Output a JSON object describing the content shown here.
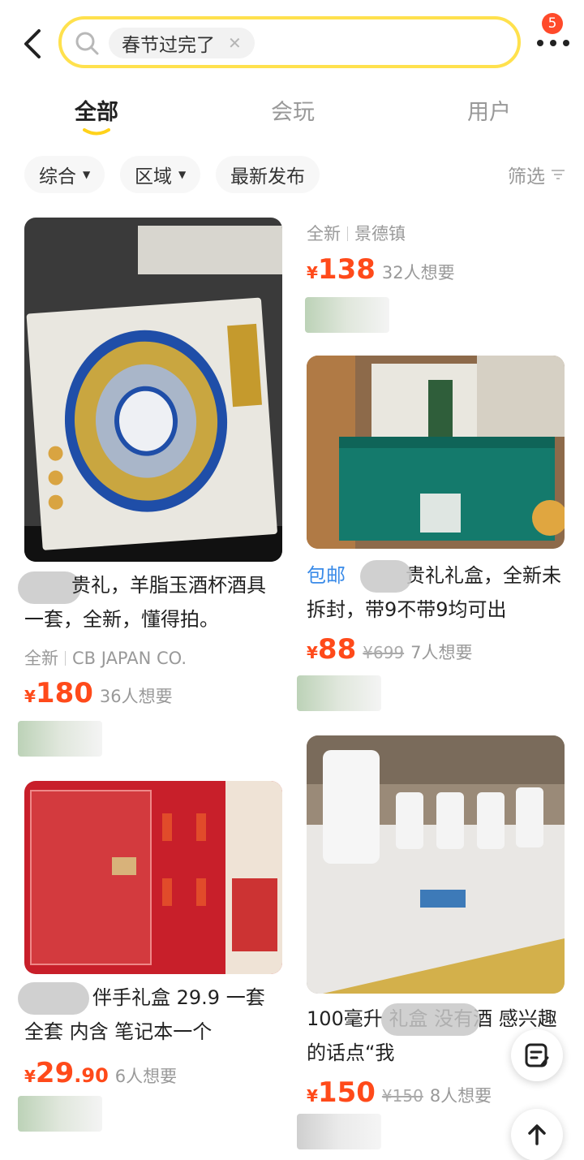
{
  "header": {
    "search_query": "春节过完了",
    "notification_count": "5"
  },
  "tabs": [
    {
      "label": "全部"
    },
    {
      "label": "会玩"
    },
    {
      "label": "用户"
    }
  ],
  "filters": {
    "sort": "综合",
    "region": "区域",
    "latest": "最新发布",
    "screen": "筛选"
  },
  "items": [
    {
      "title": "贵礼，羊脂玉酒杯酒具一套，全新，懂得拍。",
      "condition": "全新",
      "brand": "CB JAPAN CO.",
      "price": "180",
      "wants": "36人想要"
    },
    {
      "condition": "全新",
      "location": "景德镇",
      "price": "138",
      "wants": "32人想要"
    },
    {
      "tag": "包邮",
      "title": "贵礼礼盒，全新未拆封，带9不带9均可出",
      "price": "88",
      "original_price": "¥699",
      "wants": "7人想要"
    },
    {
      "title": "伴手礼盒 29.9 一套 全套 内含 笔记本一个",
      "price_int": "29",
      "price_dec": ".90",
      "wants": "6人想要"
    },
    {
      "title": "100毫升 礼盒 没有酒 感兴趣的话点“我",
      "price": "150",
      "original_price": "¥150",
      "wants": "8人想要"
    }
  ],
  "currency_symbol": "¥",
  "colors": {
    "accent_yellow": "#ffe14d",
    "price_red": "#ff4a1a",
    "badge_red": "#ff4a2a",
    "link_blue": "#3a8be8"
  }
}
